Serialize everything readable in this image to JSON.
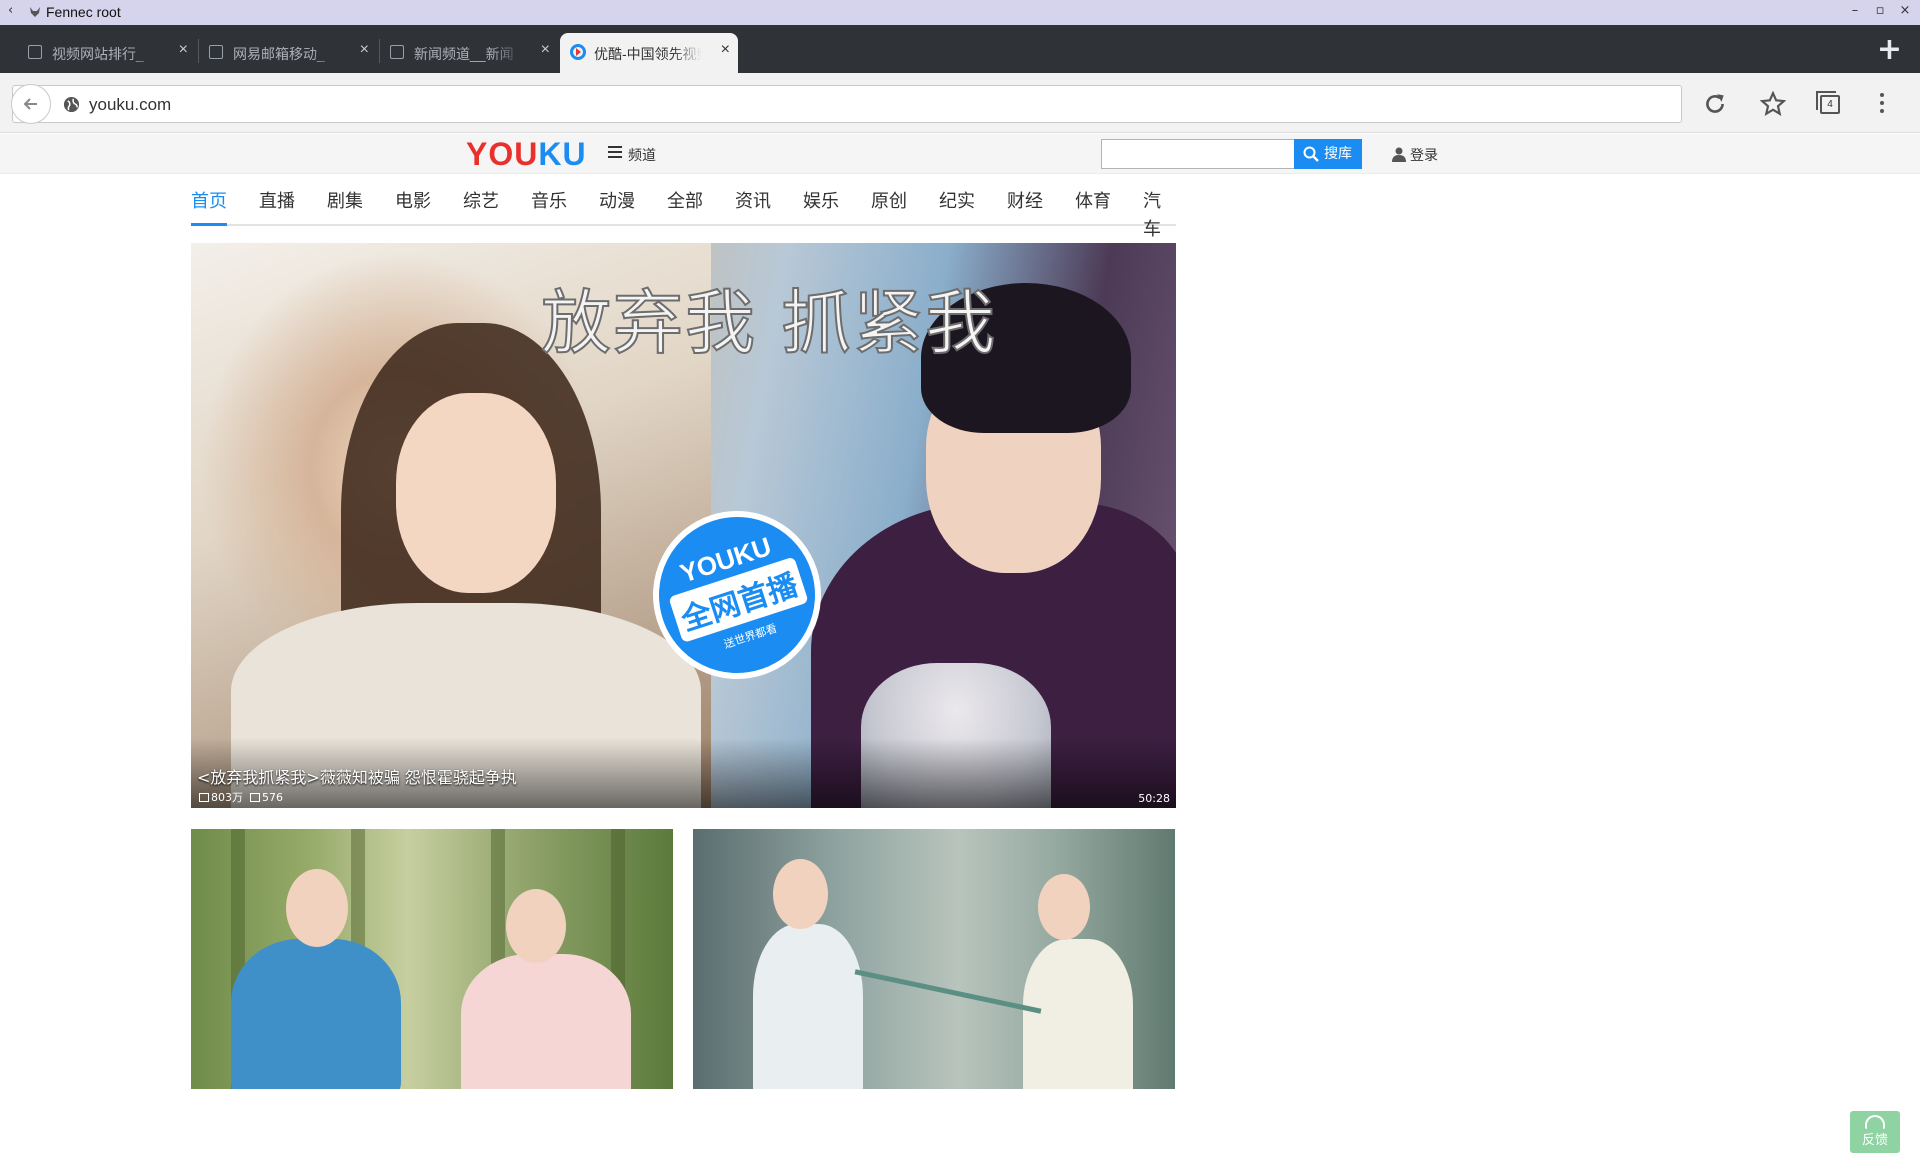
{
  "window": {
    "title": "Fennec root"
  },
  "tabs": [
    {
      "label": "视频网站排行_",
      "active": false
    },
    {
      "label": "网易邮箱移动_",
      "active": false
    },
    {
      "label": "新闻频道__新闻",
      "active": false
    },
    {
      "label": "优酷-中国领先视频",
      "active": true
    }
  ],
  "tab_close_glyph": "×",
  "new_tab_glyph": "+",
  "toolbar": {
    "url": "youku.com",
    "tab_count": "4"
  },
  "header": {
    "logo_left": "YOU",
    "logo_right": "KU",
    "channel_menu": "频道",
    "search_placeholder": "",
    "search_button": "搜库",
    "login": "登录"
  },
  "nav": [
    "首页",
    "直播",
    "剧集",
    "电影",
    "综艺",
    "音乐",
    "动漫",
    "全部",
    "资讯",
    "娱乐",
    "原创",
    "纪实",
    "财经",
    "体育",
    "汽车"
  ],
  "hero": {
    "overlay_title": "放弃我 抓紧我",
    "badge_top": "YOUKU",
    "badge_main": "全网首播",
    "badge_sub": "送世界都看",
    "caption": "<放弃我抓紧我>薇薇知被骗 怨恨霍骁起争执",
    "views": "803万",
    "comments": "576",
    "duration": "50:28"
  },
  "feedback": {
    "label": "反馈"
  }
}
